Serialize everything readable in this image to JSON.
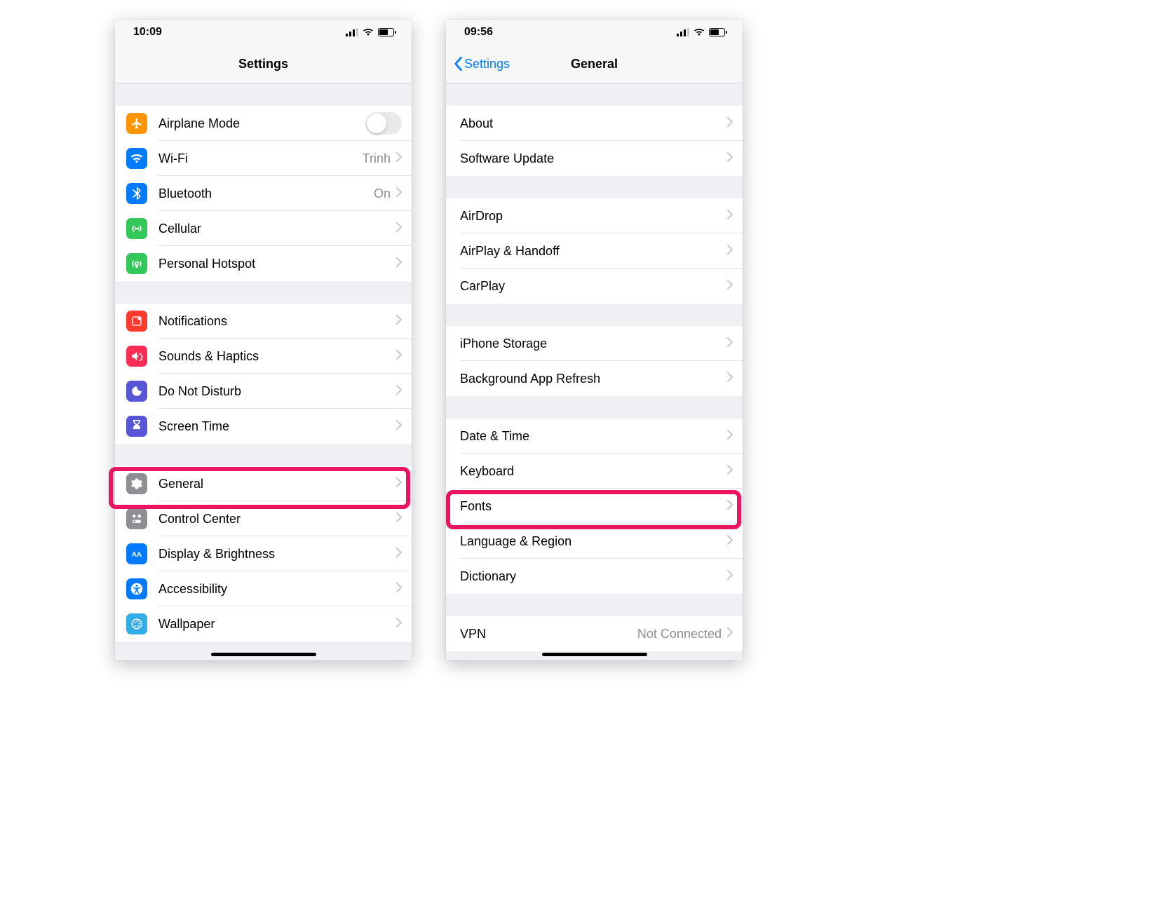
{
  "left": {
    "status_time": "10:09",
    "title": "Settings",
    "groups": [
      [
        {
          "icon": "airplane-icon",
          "bg": "bg-orange",
          "label": "Airplane Mode",
          "toggle": true,
          "toggle_on": false
        },
        {
          "icon": "wifi-icon",
          "bg": "bg-blue",
          "label": "Wi-Fi",
          "detail": "Trinh",
          "chevron": true
        },
        {
          "icon": "bluetooth-icon",
          "bg": "bg-blue",
          "label": "Bluetooth",
          "detail": "On",
          "chevron": true
        },
        {
          "icon": "cellular-icon",
          "bg": "bg-green",
          "label": "Cellular",
          "chevron": true
        },
        {
          "icon": "hotspot-icon",
          "bg": "bg-green",
          "label": "Personal Hotspot",
          "chevron": true
        }
      ],
      [
        {
          "icon": "notifications-icon",
          "bg": "bg-red",
          "label": "Notifications",
          "chevron": true
        },
        {
          "icon": "sounds-icon",
          "bg": "bg-pink",
          "label": "Sounds & Haptics",
          "chevron": true
        },
        {
          "icon": "dnd-icon",
          "bg": "bg-purple",
          "label": "Do Not Disturb",
          "chevron": true
        },
        {
          "icon": "screentime-icon",
          "bg": "bg-purple",
          "label": "Screen Time",
          "chevron": true
        }
      ],
      [
        {
          "icon": "general-icon",
          "bg": "bg-gray",
          "label": "General",
          "chevron": true,
          "highlight": true
        },
        {
          "icon": "controlcenter-icon",
          "bg": "bg-gray",
          "label": "Control Center",
          "chevron": true
        },
        {
          "icon": "display-icon",
          "bg": "bg-blue",
          "label": "Display & Brightness",
          "chevron": true
        },
        {
          "icon": "accessibility-icon",
          "bg": "bg-blue",
          "label": "Accessibility",
          "chevron": true
        },
        {
          "icon": "wallpaper-icon",
          "bg": "bg-teal",
          "label": "Wallpaper",
          "chevron": true
        }
      ]
    ]
  },
  "right": {
    "status_time": "09:56",
    "back_label": "Settings",
    "title": "General",
    "groups": [
      [
        {
          "label": "About",
          "chevron": true
        },
        {
          "label": "Software Update",
          "chevron": true
        }
      ],
      [
        {
          "label": "AirDrop",
          "chevron": true
        },
        {
          "label": "AirPlay & Handoff",
          "chevron": true
        },
        {
          "label": "CarPlay",
          "chevron": true
        }
      ],
      [
        {
          "label": "iPhone Storage",
          "chevron": true
        },
        {
          "label": "Background App Refresh",
          "chevron": true
        }
      ],
      [
        {
          "label": "Date & Time",
          "chevron": true
        },
        {
          "label": "Keyboard",
          "chevron": true
        },
        {
          "label": "Fonts",
          "chevron": true,
          "highlight": true
        },
        {
          "label": "Language & Region",
          "chevron": true
        },
        {
          "label": "Dictionary",
          "chevron": true
        }
      ],
      [
        {
          "label": "VPN",
          "detail": "Not Connected",
          "chevron": true
        }
      ]
    ]
  }
}
